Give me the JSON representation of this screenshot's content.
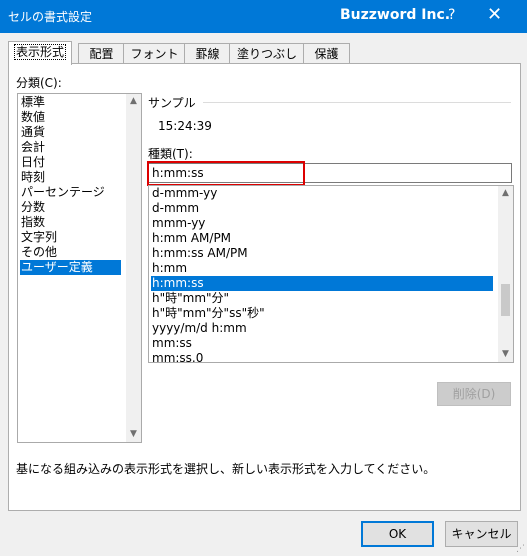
{
  "window": {
    "title": "セルの書式設定",
    "brand": "Buzzword Inc.",
    "help_label": "?",
    "close_label": "✕"
  },
  "tabs": [
    {
      "label": "表示形式",
      "active": true
    },
    {
      "label": "配置",
      "active": false
    },
    {
      "label": "フォント",
      "active": false
    },
    {
      "label": "罫線",
      "active": false
    },
    {
      "label": "塗りつぶし",
      "active": false
    },
    {
      "label": "保護",
      "active": false
    }
  ],
  "category": {
    "label": "分類(C):",
    "items": [
      "標準",
      "数値",
      "通貨",
      "会計",
      "日付",
      "時刻",
      "パーセンテージ",
      "分数",
      "指数",
      "文字列",
      "その他",
      "ユーザー定義"
    ],
    "selected_index": 11
  },
  "sample": {
    "label": "サンプル",
    "value": "15:24:39"
  },
  "type": {
    "label": "種類(T):",
    "input_value": "h:mm:ss",
    "items": [
      "d-mmm-yy",
      "d-mmm",
      "mmm-yy",
      "h:mm AM/PM",
      "h:mm:ss AM/PM",
      "h:mm",
      "h:mm:ss",
      "h\"時\"mm\"分\"",
      "h\"時\"mm\"分\"ss\"秒\"",
      "yyyy/m/d h:mm",
      "mm:ss",
      "mm:ss.0"
    ],
    "selected_index": 6
  },
  "delete_button": "削除(D)",
  "description": "基になる組み込みの表示形式を選択し、新しい表示形式を入力してください。",
  "ok_button": "OK",
  "cancel_button": "キャンセル"
}
